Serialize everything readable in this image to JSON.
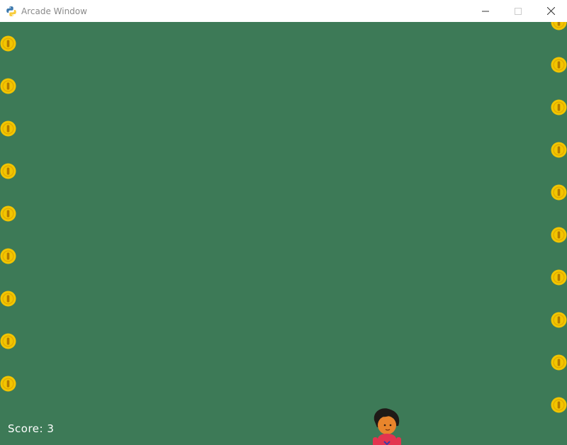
{
  "window": {
    "title": "Arcade Window",
    "icons": {
      "app": "python-icon",
      "minimize": "minimize-icon",
      "maximize": "maximize-icon",
      "close": "close-icon"
    }
  },
  "game": {
    "background_color": "#3d7a57",
    "score_text": "Score: 3",
    "coin_color": "#f2c500",
    "coin_icon": "coin-icon",
    "player_icon": "player-character-icon",
    "left_coin_count": 9,
    "right_coin_count": 9
  }
}
